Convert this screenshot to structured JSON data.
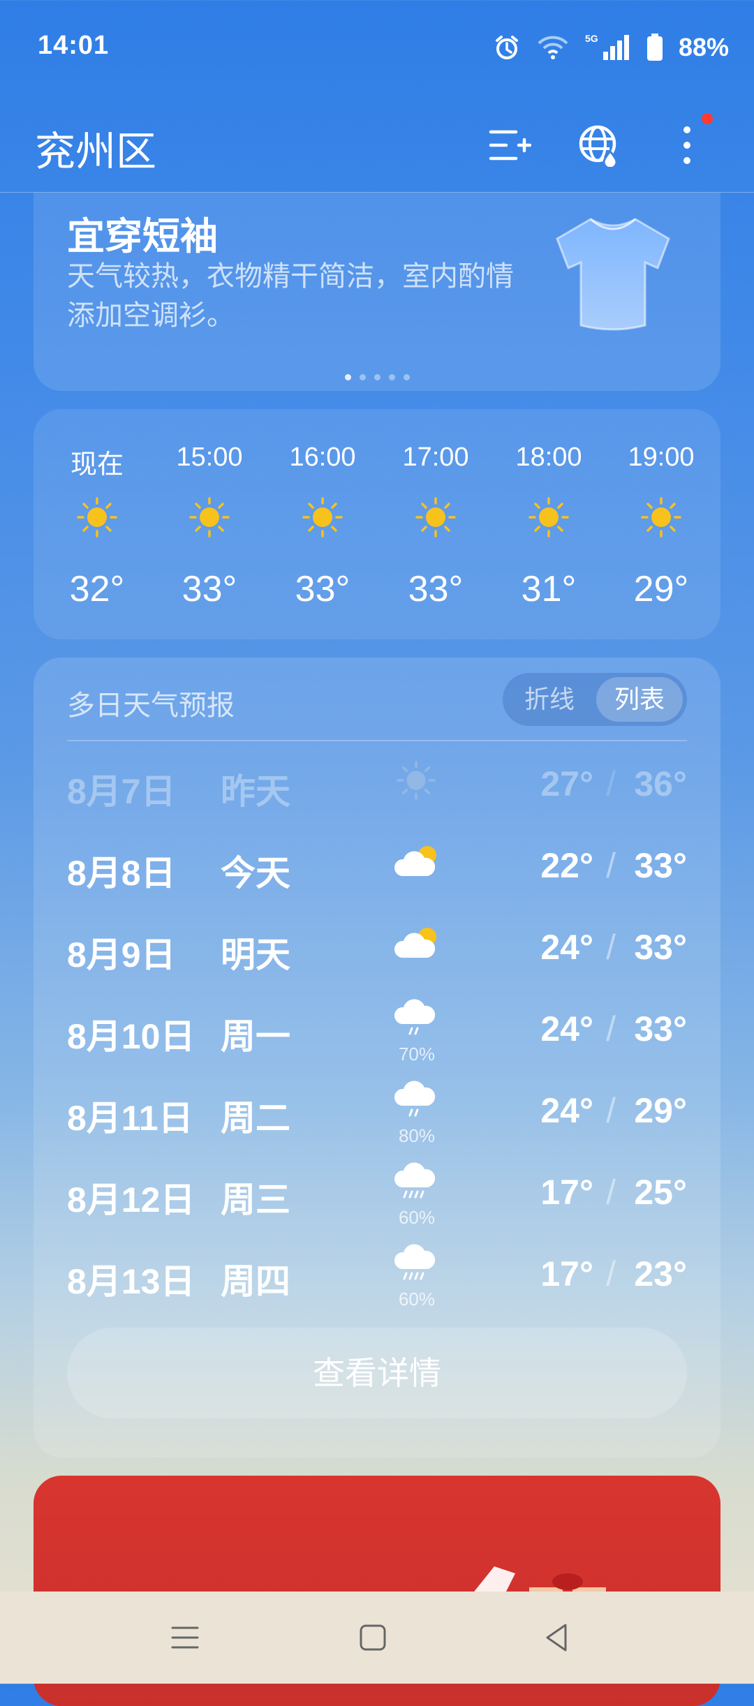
{
  "status_bar": {
    "time": "14:01",
    "network": "5G",
    "battery": "88%"
  },
  "header": {
    "city": "兖州区"
  },
  "clothing_card": {
    "title": "宜穿短袖",
    "description": "天气较热，衣物精干简洁，室内酌情添加空调衫。",
    "page_count": 5,
    "active_page": 1
  },
  "hourly": [
    {
      "time": "现在",
      "icon": "sun-icon",
      "temp": "32°"
    },
    {
      "time": "15:00",
      "icon": "sun-icon",
      "temp": "33°"
    },
    {
      "time": "16:00",
      "icon": "sun-icon",
      "temp": "33°"
    },
    {
      "time": "17:00",
      "icon": "sun-icon",
      "temp": "33°"
    },
    {
      "time": "18:00",
      "icon": "sun-icon",
      "temp": "31°"
    },
    {
      "time": "19:00",
      "icon": "sun-icon",
      "temp": "29°"
    }
  ],
  "forecast": {
    "title": "多日天气预报",
    "toggle_line": "折线",
    "toggle_list": "列表",
    "days": [
      {
        "date": "8月7日",
        "day": "昨天",
        "icon": "sun-icon",
        "precip": "",
        "low": "27°",
        "high": "36°"
      },
      {
        "date": "8月8日",
        "day": "今天",
        "icon": "partly-cloudy-icon",
        "precip": "",
        "low": "22°",
        "high": "33°"
      },
      {
        "date": "8月9日",
        "day": "明天",
        "icon": "partly-cloudy-icon",
        "precip": "",
        "low": "24°",
        "high": "33°"
      },
      {
        "date": "8月10日",
        "day": "周一",
        "icon": "light-rain-icon",
        "precip": "70%",
        "low": "24°",
        "high": "33°"
      },
      {
        "date": "8月11日",
        "day": "周二",
        "icon": "light-rain-icon",
        "precip": "80%",
        "low": "24°",
        "high": "29°"
      },
      {
        "date": "8月12日",
        "day": "周三",
        "icon": "rain-icon",
        "precip": "60%",
        "low": "17°",
        "high": "25°"
      },
      {
        "date": "8月13日",
        "day": "周四",
        "icon": "rain-icon",
        "precip": "60%",
        "low": "17°",
        "high": "23°"
      }
    ],
    "detail_button": "查看详情"
  },
  "colors": {
    "sun": "#f8c21c",
    "ad_red": "#d8352f",
    "notify_dot": "#ff3b30"
  }
}
